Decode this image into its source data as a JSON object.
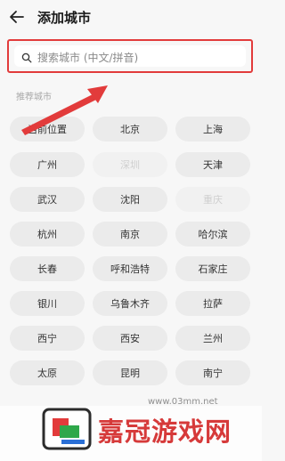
{
  "header": {
    "title": "添加城市",
    "back_icon": "arrow-left-icon"
  },
  "search": {
    "placeholder": "搜索城市 (中文/拼音)",
    "icon": "search-icon",
    "highlight_color": "#e23b3b"
  },
  "section": {
    "label": "推荐城市"
  },
  "cities": [
    {
      "name": "当前位置",
      "state": "normal"
    },
    {
      "name": "北京",
      "state": "normal"
    },
    {
      "name": "上海",
      "state": "normal"
    },
    {
      "name": "广州",
      "state": "normal"
    },
    {
      "name": "深圳",
      "state": "added"
    },
    {
      "name": "天津",
      "state": "normal"
    },
    {
      "name": "武汉",
      "state": "normal"
    },
    {
      "name": "沈阳",
      "state": "normal"
    },
    {
      "name": "重庆",
      "state": "added"
    },
    {
      "name": "杭州",
      "state": "normal"
    },
    {
      "name": "南京",
      "state": "normal"
    },
    {
      "name": "哈尔滨",
      "state": "normal"
    },
    {
      "name": "长春",
      "state": "normal"
    },
    {
      "name": "呼和浩特",
      "state": "normal"
    },
    {
      "name": "石家庄",
      "state": "normal"
    },
    {
      "name": "银川",
      "state": "normal"
    },
    {
      "name": "乌鲁木齐",
      "state": "normal"
    },
    {
      "name": "拉萨",
      "state": "normal"
    },
    {
      "name": "西宁",
      "state": "normal"
    },
    {
      "name": "西安",
      "state": "normal"
    },
    {
      "name": "兰州",
      "state": "normal"
    },
    {
      "name": "太原",
      "state": "normal"
    },
    {
      "name": "昆明",
      "state": "normal"
    },
    {
      "name": "南宁",
      "state": "normal"
    }
  ],
  "annotation": {
    "arrow_color": "#e23b3b"
  },
  "watermark": {
    "brand": "嘉冠游戏网",
    "url": "www.03mm.net"
  }
}
